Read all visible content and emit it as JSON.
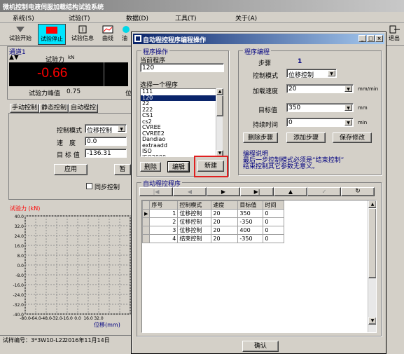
{
  "app": {
    "title": "微机控制电液伺服加载结构试验系统"
  },
  "menu": [
    "系统(S)",
    "试验(T)",
    "数据(D)",
    "工具(T)",
    "关于(A)"
  ],
  "toolbar": {
    "start": "试验开始",
    "stop": "试验停止",
    "info": "试验信息",
    "curve": "曲线",
    "oil": "油",
    "exit": "退出"
  },
  "channel": {
    "label": "通道1",
    "force_label": "试验力",
    "unit": "kN",
    "value": "-0.66",
    "peak_label": "试验力峰值",
    "peak_value": "0.75",
    "pos_cut": "位"
  },
  "tabs": [
    "手动控制",
    "静态控制",
    "自动程控"
  ],
  "manual": {
    "mode_label": "控制模式",
    "mode_value": "位移控制",
    "speed_label": "速　度",
    "speed_value": "0.0",
    "target_label": "目 标 值",
    "target_value": "-136.31",
    "apply": "应用",
    "pause": "暂",
    "sync": "同步控制"
  },
  "plot": {
    "title": "试验力 (kN)",
    "xlabel": "位移(mm)",
    "yticks": [
      "40.0",
      "32.0",
      "24.0",
      "16.0",
      "8.0",
      "0.0",
      "-8.0",
      "-16.0",
      "-24.0",
      "-32.0",
      "-40.0"
    ],
    "xticks": [
      "-80.0",
      "-64.0",
      "-48.0",
      "-32.0",
      "-16.0",
      "0.0",
      "16.0",
      "32.0"
    ]
  },
  "status": {
    "test_no": "试样编号：3*3W10-L22",
    "date": "2016年11月14日"
  },
  "dialog": {
    "title": "自动程控程序编程操作",
    "prog_ops": "程序操作",
    "current_label": "当前程序",
    "current_value": "120",
    "select_label": "选择一个程序",
    "programs": [
      "111",
      "120",
      "22",
      "222",
      "CS1",
      "cs2",
      "CVREE",
      "CVREE2",
      "Dandiao",
      "extraadd",
      "ISO",
      "ISO2000"
    ],
    "selected_program": "120",
    "delete": "删除",
    "edit": "编辑",
    "new": "新建",
    "prog_edit": "程序编程",
    "step_label": "步骤",
    "step_value": "1",
    "mode_label": "控制模式",
    "mode_value": "位移控制",
    "speed_label": "加载速度",
    "speed_value": "20",
    "speed_unit": "mm/min",
    "target_label": "目标值",
    "target_value": "350",
    "target_unit": "mm",
    "hold_label": "持续时间",
    "hold_value": "0",
    "hold_unit": "min",
    "del_step": "删除步骤",
    "add_step": "添加步骤",
    "save": "保存修改",
    "note_title": "编程说明",
    "note1": "最后一步控制模式必须是“结束控制”",
    "note2": "结束控制其它参数无意义。",
    "auto_prog": "自动程控程序",
    "grid_headers": [
      "序号",
      "控制模式",
      "速度",
      "目标值",
      "时间"
    ],
    "rows": [
      [
        "1",
        "位移控制",
        "20",
        "350",
        "0"
      ],
      [
        "2",
        "位移控制",
        "20",
        "-350",
        "0"
      ],
      [
        "3",
        "位移控制",
        "20",
        "400",
        "0"
      ],
      [
        "4",
        "结束控制",
        "20",
        "-350",
        "0"
      ]
    ],
    "ok": "确认"
  }
}
